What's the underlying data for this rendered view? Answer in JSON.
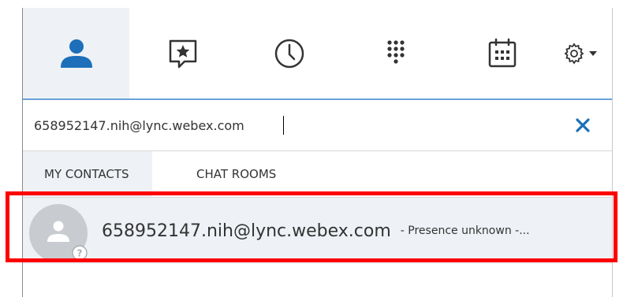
{
  "nav": {
    "items": [
      {
        "key": "contacts",
        "icon": "person-icon",
        "active": true
      },
      {
        "key": "chat",
        "icon": "chat-star-icon",
        "active": false
      },
      {
        "key": "history",
        "icon": "clock-icon",
        "active": false
      },
      {
        "key": "dialpad",
        "icon": "dialpad-icon",
        "active": false
      },
      {
        "key": "calendar",
        "icon": "calendar-icon",
        "active": false
      },
      {
        "key": "settings",
        "icon": "gear-icon",
        "active": false
      }
    ]
  },
  "search": {
    "value": "658952147.nih@lync.webex.com"
  },
  "tabs": {
    "my_contacts": "MY CONTACTS",
    "chat_rooms": "CHAT ROOMS"
  },
  "results": [
    {
      "name": "658952147.nih@lync.webex.com",
      "status": "- Presence unknown -..."
    }
  ],
  "colors": {
    "accent": "#1c6fb8",
    "panel_active": "#eef1f5",
    "divider": "#6aa2d8",
    "highlight": "#ff0000",
    "avatar": "#c8cbd0"
  }
}
